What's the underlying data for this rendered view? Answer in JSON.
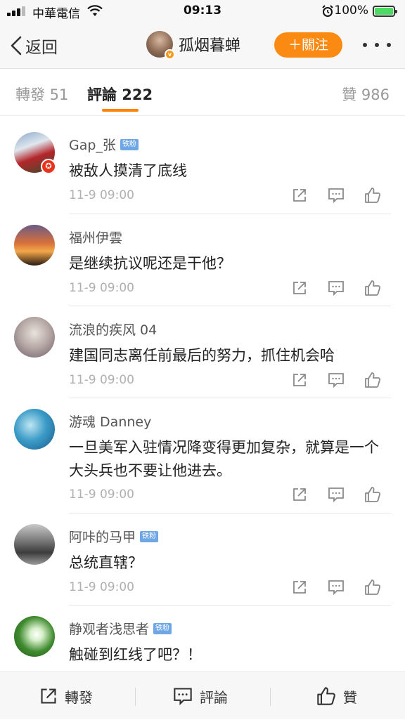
{
  "status": {
    "carrier": "中華電信",
    "time": "09:13",
    "battery": "100%"
  },
  "nav": {
    "back": "返回",
    "username": "孤烟暮蝉",
    "follow": "＋關注"
  },
  "tabs": {
    "reposts": "轉發 51",
    "comments": "評論 222",
    "likes": "贊 986"
  },
  "comments": [
    {
      "name": "Gap_张",
      "badge": "铁粉",
      "text": "被敌人摸清了底线",
      "time": "11-9 09:00"
    },
    {
      "name": "福州伊雲",
      "badge": "",
      "text": "是继续抗议呢还是干他？",
      "time": "11-9 09:00"
    },
    {
      "name": "流浪的疾风 04",
      "badge": "",
      "text": "建国同志离任前最后的努力，抓住机会哈",
      "time": "11-9 09:00"
    },
    {
      "name": "游魂 Danney",
      "badge": "",
      "text": "一旦美军入驻情况降变得更加复杂，就算是一个大头兵也不要让他进去。",
      "time": "11-9 09:00"
    },
    {
      "name": "阿咔的马甲",
      "badge": "铁粉",
      "text": "总统直辖？",
      "time": "11-9 09:00"
    },
    {
      "name": "静观者浅思者",
      "badge": "铁粉",
      "text": "触碰到红线了吧？！",
      "time": ""
    }
  ],
  "bottom": {
    "repost": "轉發",
    "comment": "評論",
    "like": "贊"
  }
}
